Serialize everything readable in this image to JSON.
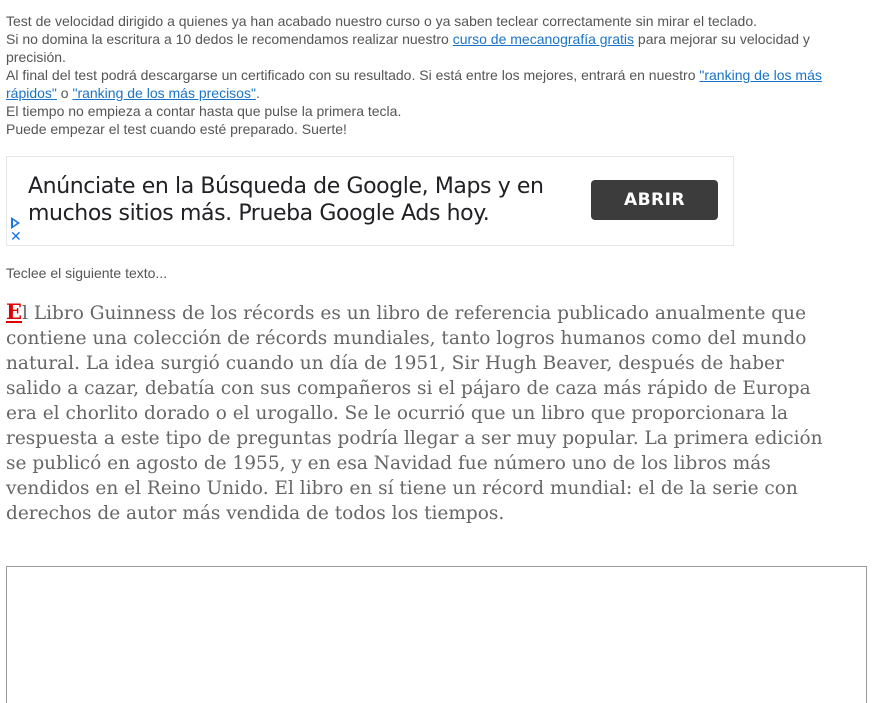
{
  "intro": {
    "line1": "Test de velocidad dirigido a quienes ya han acabado nuestro curso o ya saben teclear correctamente sin mirar el teclado.",
    "line2_before": "Si no domina la escritura a 10 dedos le recomendamos realizar nuestro ",
    "line2_link": "curso de mecanografía gratis",
    "line2_after": " para mejorar su velocidad y precisión.",
    "line3_before": "Al final del test podrá descargarse un certificado con su resultado. Si está entre los mejores, entrará en nuestro ",
    "line3_link1": "\"ranking de los más rápidos\"",
    "line3_middle": " o ",
    "line3_link2": "\"ranking de los más precisos\"",
    "line3_after": ".",
    "line4": "El tiempo no empieza a contar hasta que pulse la primera tecla.",
    "line5": "Puede empezar el test cuando esté preparado. Suerte!"
  },
  "ad": {
    "headline": "Anúnciate en la Búsqueda de Google, Maps y en muchos sitios más. Prueba Google Ads hoy.",
    "button_label": "ABRIR",
    "close_glyph": "✕",
    "icons": [
      "adchoices-play-icon",
      "close-icon"
    ]
  },
  "prompt": "Teclee el siguiente texto...",
  "typing_text": {
    "current_char": "E",
    "remaining": "l Libro Guinness de los récords es un libro de referencia publicado anualmente que contiene una colección de récords mundiales, tanto logros humanos como del mundo natural. La idea surgió cuando un día de 1951, Sir Hugh Beaver, después de haber salido a cazar, debatía con sus compañeros si el pájaro de caza más rápido de Europa era el chorlito dorado o el urogallo. Se le ocurrió que un libro que proporcionara la respuesta a este tipo de preguntas podría llegar a ser muy popular. La primera edición se publicó en agosto de 1955, y en esa Navidad fue número uno de los libros más vendidos en el Reino Unido. El libro en sí tiene un récord mundial: el de la serie con derechos de autor más vendida de todos los tiempos."
  },
  "typing_area": {
    "value": ""
  },
  "colors": {
    "link": "#1a73c8",
    "current_char": "#e00000",
    "text_gray": "#666666",
    "ad_button": "#3c3c3c",
    "ad_icon": "#1a73e8"
  }
}
